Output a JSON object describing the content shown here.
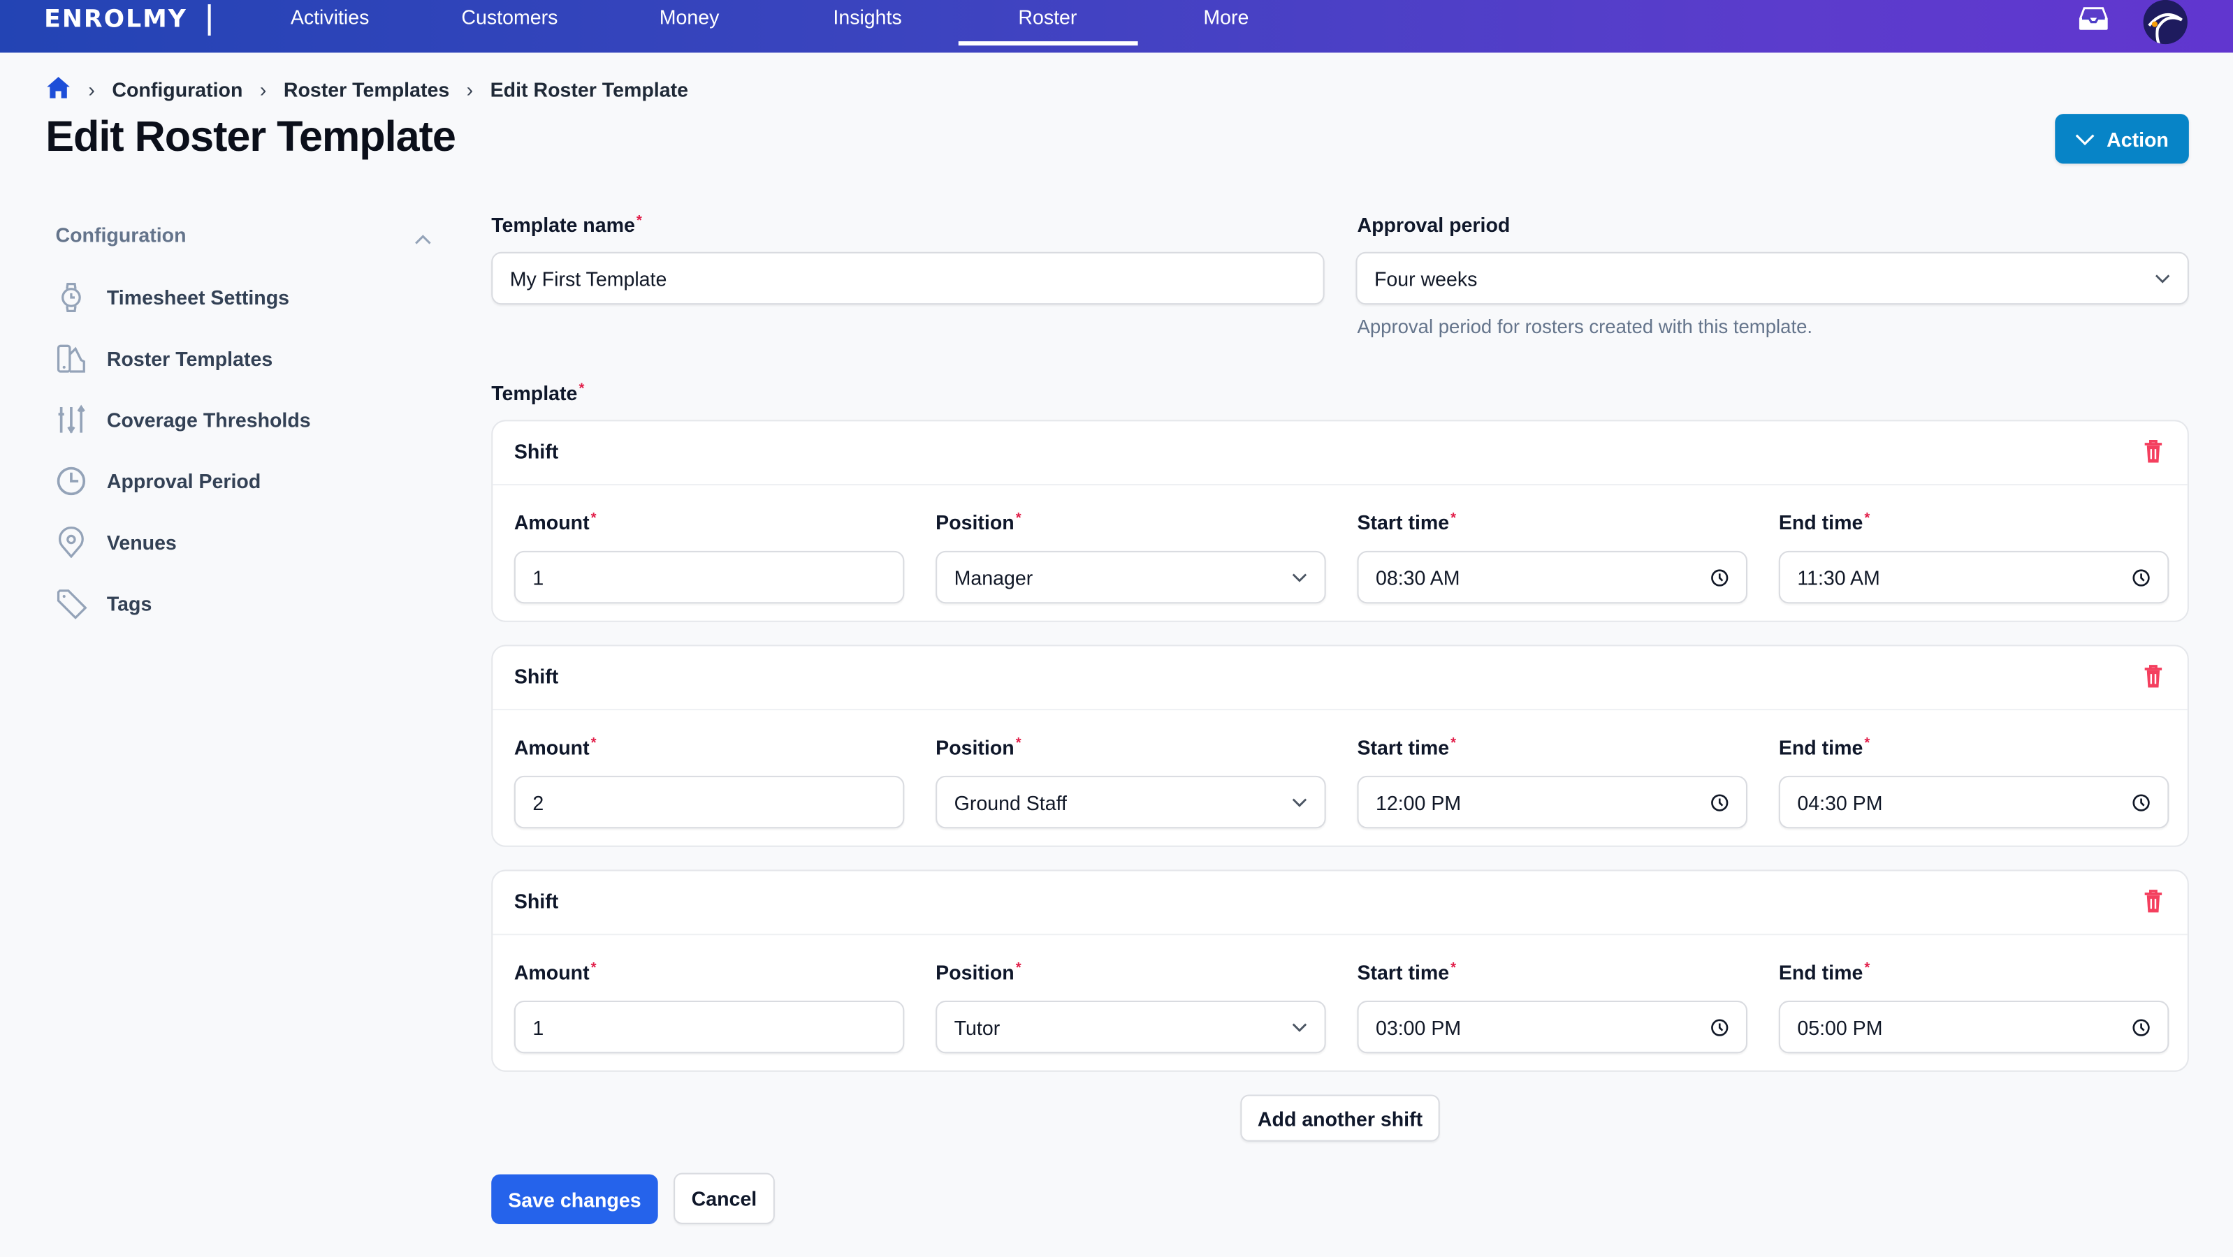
{
  "nav": {
    "logo": "ENROLMY",
    "items": [
      "Activities",
      "Customers",
      "Money",
      "Insights",
      "Roster",
      "More"
    ],
    "active": "Roster"
  },
  "breadcrumb": [
    "Configuration",
    "Roster Templates",
    "Edit Roster Template"
  ],
  "page": {
    "title": "Edit Roster Template",
    "action_label": "Action"
  },
  "sidebar": {
    "heading": "Configuration",
    "items": [
      {
        "label": "Timesheet Settings",
        "icon": "watch-icon"
      },
      {
        "label": "Roster Templates",
        "icon": "swatch-icon"
      },
      {
        "label": "Coverage Thresholds",
        "icon": "sliders-icon"
      },
      {
        "label": "Approval Period",
        "icon": "clock-icon"
      },
      {
        "label": "Venues",
        "icon": "map-pin-icon"
      },
      {
        "label": "Tags",
        "icon": "tag-icon"
      }
    ]
  },
  "form": {
    "template_name_label": "Template name",
    "template_name_value": "My First Template",
    "approval_label": "Approval period",
    "approval_value": "Four weeks",
    "approval_help": "Approval period for rosters created with this template.",
    "template_label": "Template",
    "shift_title": "Shift",
    "amount_label": "Amount",
    "position_label": "Position",
    "start_label": "Start time",
    "end_label": "End time",
    "shifts": [
      {
        "amount": "1",
        "position": "Manager",
        "start": "08:30 AM",
        "end": "11:30 AM"
      },
      {
        "amount": "2",
        "position": "Ground Staff",
        "start": "12:00 PM",
        "end": "04:30 PM"
      },
      {
        "amount": "1",
        "position": "Tutor",
        "start": "03:00 PM",
        "end": "05:00 PM"
      }
    ],
    "add_shift_label": "Add another shift",
    "save_label": "Save changes",
    "cancel_label": "Cancel"
  },
  "colors": {
    "primary": "#2563eb",
    "action": "#0784c7",
    "danger": "#f43f5e",
    "required": "#e11d48"
  }
}
